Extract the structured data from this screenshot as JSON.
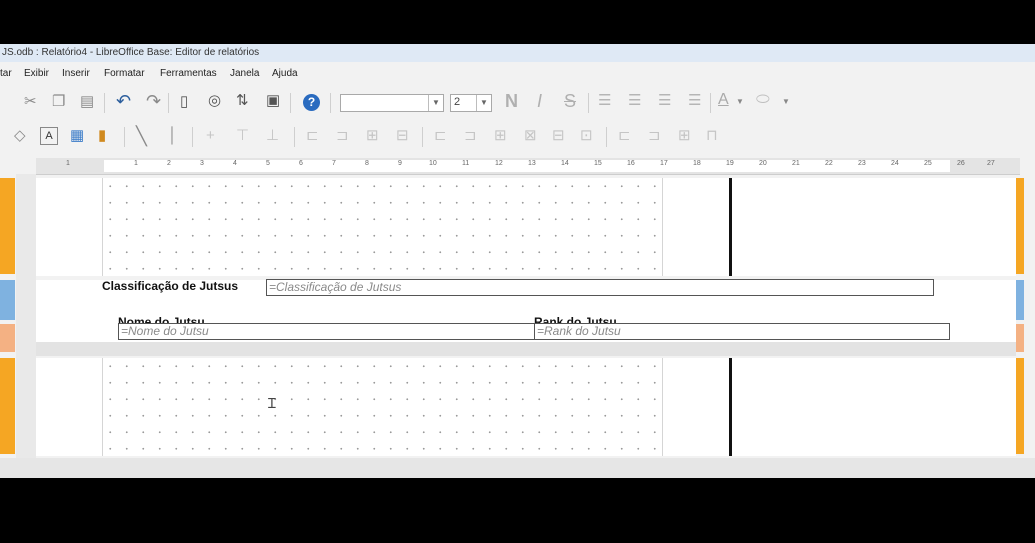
{
  "window": {
    "title": "JS.odb : Relatório4 - LibreOffice Base: Editor de relatórios"
  },
  "menu": [
    "tar",
    "Exibir",
    "Inserir",
    "Formatar",
    "Ferramentas",
    "Janela",
    "Ajuda"
  ],
  "toolbar": {
    "font_name_value": "",
    "font_size_value": "2",
    "bold_glyph": "N",
    "italic_glyph": "I",
    "strike_glyph": "S",
    "help_glyph": "?"
  },
  "ruler": {
    "numbers": [
      "1",
      "1",
      "2",
      "3",
      "4",
      "5",
      "6",
      "7",
      "8",
      "9",
      "10",
      "11",
      "12",
      "13",
      "14",
      "15",
      "16",
      "17",
      "18",
      "19",
      "20",
      "21",
      "22",
      "23",
      "24",
      "25",
      "26",
      "27"
    ]
  },
  "report": {
    "group_header": {
      "label": "Classificação de Jutsus",
      "field": "=Classificação de Jutsus"
    },
    "detail": {
      "col1_label": "Nome do Jutsu",
      "col1_field": "=Nome do Jutsu",
      "col2_label": "Rank do Jutsu",
      "col2_field": "=Rank do Jutsu"
    }
  },
  "colors": {
    "section_tab_page_header": "#f5a623",
    "section_tab_group": "#7fb2e0",
    "section_tab_detail": "#f4b183",
    "section_tab_page_footer": "#f5a623",
    "accent_help": "#2a6bbf"
  }
}
